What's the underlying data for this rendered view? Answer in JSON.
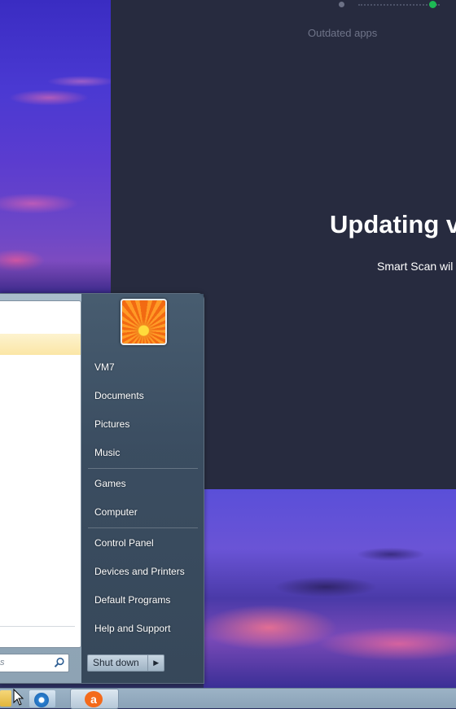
{
  "app": {
    "step_label": "Outdated apps",
    "heading": "Updating v",
    "subheading": "Smart Scan wil"
  },
  "start_menu": {
    "search_placeholder": "s",
    "user_items": [
      "VM7",
      "Documents",
      "Pictures",
      "Music"
    ],
    "system_items": [
      "Games",
      "Computer"
    ],
    "settings_items": [
      "Control Panel",
      "Devices and Printers",
      "Default Programs",
      "Help and Support"
    ],
    "shutdown_label": "Shut down",
    "shutdown_arrow": "▶"
  },
  "taskbar": {
    "avast_glyph": "a"
  },
  "colors": {
    "app_bg": "#272b3f",
    "progress_active": "#1db954",
    "avast_orange": "#f46a1a"
  }
}
